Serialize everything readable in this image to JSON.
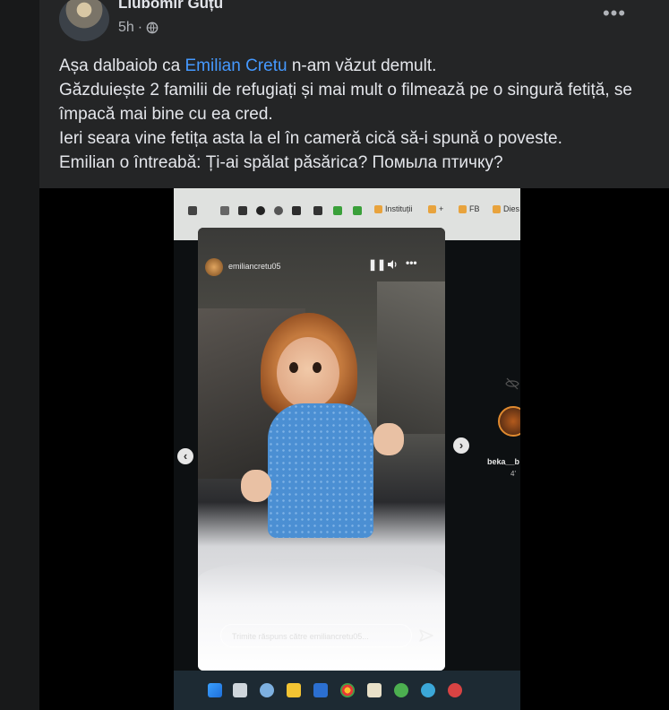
{
  "post": {
    "author": "Liubomir Guțu",
    "time": "5h",
    "separator": "·",
    "more_label": "•••",
    "text": {
      "line1_pre": "Așa dalbaiob ca ",
      "mention": "Emilian Cretu",
      "line1_post": " n-am văzut demult.",
      "line2": "Găzduiește 2 familii de refugiați și mai mult o filmează pe o singură fetiță, se împacă mai bine cu ea cred.",
      "line3": "Ieri seara vine fetița asta la el în cameră cică să-i spună o poveste.",
      "line4": "Emilian o întreabă: Ți-ai spălat păsărica? Помыла птичку?"
    },
    "colors": {
      "mention": "#4599ff",
      "background": "#242526",
      "text": "#e4e6eb"
    }
  },
  "video": {
    "bookmarks": [
      {
        "label": "Instituții",
        "color": "#e8a33d"
      },
      {
        "label": "+",
        "color": "#e8a33d"
      },
      {
        "label": "FB",
        "color": "#e8a33d"
      },
      {
        "label": "Dies",
        "color": "#e8a33d"
      }
    ],
    "story": {
      "username": "emiliancretu05",
      "pause_icon": "pause-icon",
      "volume_icon": "volume-icon",
      "menu_label": "•••",
      "reply_placeholder": "Trimite răspuns către emiliancretu05...",
      "send_icon": "send-icon"
    },
    "next_story": {
      "name": "beka__b",
      "count": "4'"
    },
    "prev_arrow": "‹",
    "next_arrow": "›"
  }
}
